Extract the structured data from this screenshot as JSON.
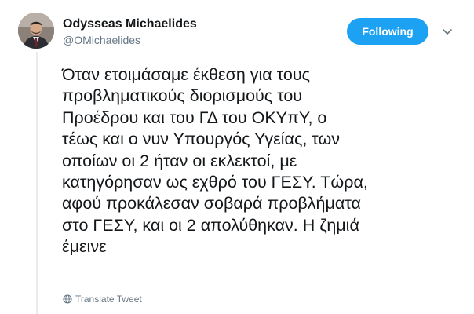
{
  "author": {
    "name": "Odysseas Michaelides",
    "handle": "@OMichaelides"
  },
  "follow_button": {
    "label": "Following",
    "color": "#1da1f2"
  },
  "menu": {
    "icon": "chevron-down-icon"
  },
  "tweet": {
    "lines": [
      "Όταν ετοιμάσαμε έκθεση για τους",
      "προβληματικούς διορισμούς του",
      "Προέδρου και του ΓΔ του ΟΚΥπΥ, ο",
      "τέως και ο νυν Υπουργός Υγείας, των",
      "οποίων οι 2 ήταν οι εκλεκτοί, με",
      "κατηγόρησαν ως εχθρό του ΓΕΣΥ. Τώρα,",
      "αφού προκάλεσαν σοβαρά προβλήματα",
      "στο ΓΕΣΥ, και οι 2 απολύθηκαν. Η ζημιά",
      "έμεινε"
    ]
  },
  "translate": {
    "label": "Translate Tweet",
    "icon": "globe-icon"
  }
}
